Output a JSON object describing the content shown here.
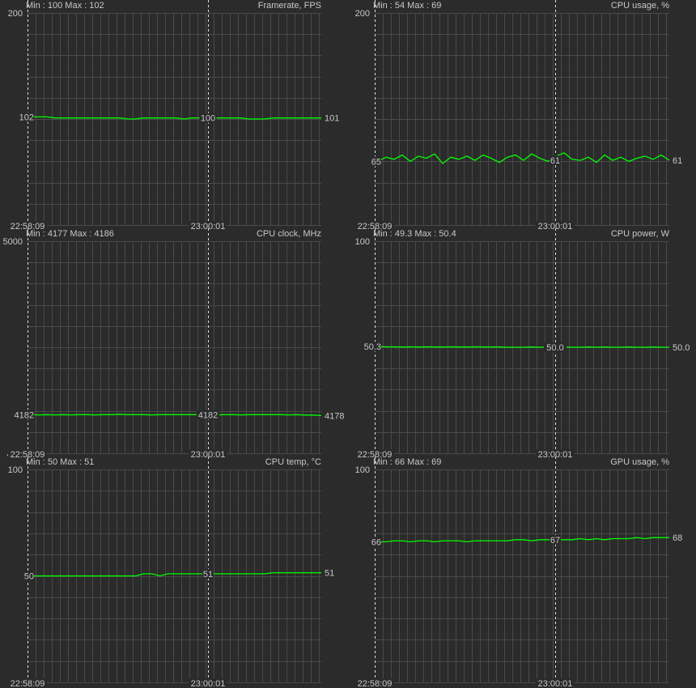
{
  "colors": {
    "background": "#2b2b2b",
    "grid": "#4a4a4a",
    "line": "#00ff00",
    "text": "#c8c8c8",
    "marker": "#e0e0e0"
  },
  "time_labels": [
    "22:58:09",
    "23:00:01"
  ],
  "chart_data": [
    {
      "type": "line",
      "title": "Framerate, FPS",
      "min_max": "Min : 100   Max : 102",
      "ylim": [
        0,
        200
      ],
      "ymax_label": "200",
      "ymin_label": "",
      "markers": [
        "102",
        "100",
        "101"
      ],
      "values": [
        102,
        102,
        102,
        101,
        101,
        101,
        101,
        101,
        101,
        101,
        101,
        101,
        100,
        100,
        101,
        101,
        101,
        101,
        101,
        100,
        101,
        101,
        101,
        101,
        101,
        101,
        101,
        100,
        100,
        100,
        101,
        101,
        101,
        101,
        101,
        101,
        101
      ]
    },
    {
      "type": "line",
      "title": "CPU usage, %",
      "min_max": "Min : 54   Max : 69",
      "ylim": [
        0,
        200
      ],
      "ymax_label": "200",
      "ymin_label": "",
      "markers": [
        "65",
        "61",
        "61"
      ],
      "values": [
        60,
        64,
        62,
        66,
        60,
        65,
        63,
        67,
        58,
        64,
        62,
        65,
        61,
        66,
        63,
        59,
        64,
        66,
        61,
        67,
        63,
        60,
        65,
        68,
        62,
        61,
        64,
        59,
        66,
        61,
        64,
        60,
        63,
        65,
        62,
        66,
        61
      ]
    },
    {
      "type": "line",
      "title": "CPU clock, MHz",
      "min_max": "Min : 4177   Max : 4186",
      "ylim": [
        4000,
        5000
      ],
      "ymax_label": "5000",
      "ymin_label": "4000",
      "markers": [
        "4182",
        "4182",
        "4178"
      ],
      "values": [
        4182,
        4181,
        4182,
        4181,
        4182,
        4181,
        4182,
        4182,
        4181,
        4182,
        4182,
        4184,
        4182,
        4182,
        4182,
        4181,
        4182,
        4182,
        4182,
        4182,
        4182,
        4182,
        4182,
        4181,
        4182,
        4182,
        4181,
        4182,
        4182,
        4182,
        4182,
        4182,
        4181,
        4182,
        4180,
        4180,
        4178
      ]
    },
    {
      "type": "line",
      "title": "CPU power, W",
      "min_max": "Min : 49.3   Max : 50.4",
      "ylim": [
        0,
        100
      ],
      "ymax_label": "100",
      "ymin_label": "",
      "markers": [
        "50.3",
        "50.0",
        "50.0"
      ],
      "values": [
        50.3,
        50.2,
        50.2,
        50.1,
        50.2,
        50.1,
        50.2,
        50.1,
        50.1,
        50.2,
        50.1,
        50.1,
        50.2,
        50.1,
        50.1,
        50.1,
        50.0,
        50.0,
        50.0,
        50.1,
        50.0,
        50.1,
        50.0,
        50.1,
        50.0,
        50.0,
        50.1,
        50.0,
        50.1,
        50.0,
        50.0,
        50.1,
        50.0,
        50.0,
        50.1,
        50.0,
        50.0
      ]
    },
    {
      "type": "line",
      "title": "CPU temp, °C",
      "min_max": "Min : 50   Max : 51",
      "ylim": [
        0,
        100
      ],
      "ymax_label": "100",
      "ymin_label": "",
      "markers": [
        "50",
        "51",
        "51"
      ],
      "values": [
        50,
        50,
        50,
        50,
        50,
        50,
        50,
        50,
        50,
        50,
        50,
        50,
        50,
        50,
        51,
        51,
        50,
        51,
        51,
        51,
        51,
        51,
        51,
        51,
        51,
        51,
        51,
        51,
        51,
        51,
        51.5,
        51.5,
        51.5,
        51.5,
        51.5,
        51.5,
        51.5
      ]
    },
    {
      "type": "line",
      "title": "GPU usage, %",
      "min_max": "Min : 66   Max : 69",
      "ylim": [
        0,
        100
      ],
      "ymax_label": "100",
      "ymin_label": "",
      "markers": [
        "66",
        "67",
        "68"
      ],
      "values": [
        66,
        66,
        66.5,
        66.5,
        66,
        66.5,
        66.5,
        66,
        66.5,
        66.5,
        66.5,
        66,
        66.5,
        66.5,
        66.5,
        66.5,
        66.5,
        67,
        67,
        66.5,
        67,
        67,
        67,
        67,
        67,
        67.5,
        67,
        67.5,
        67,
        67.5,
        67.5,
        67.5,
        68,
        67.5,
        68,
        68,
        68
      ]
    }
  ]
}
